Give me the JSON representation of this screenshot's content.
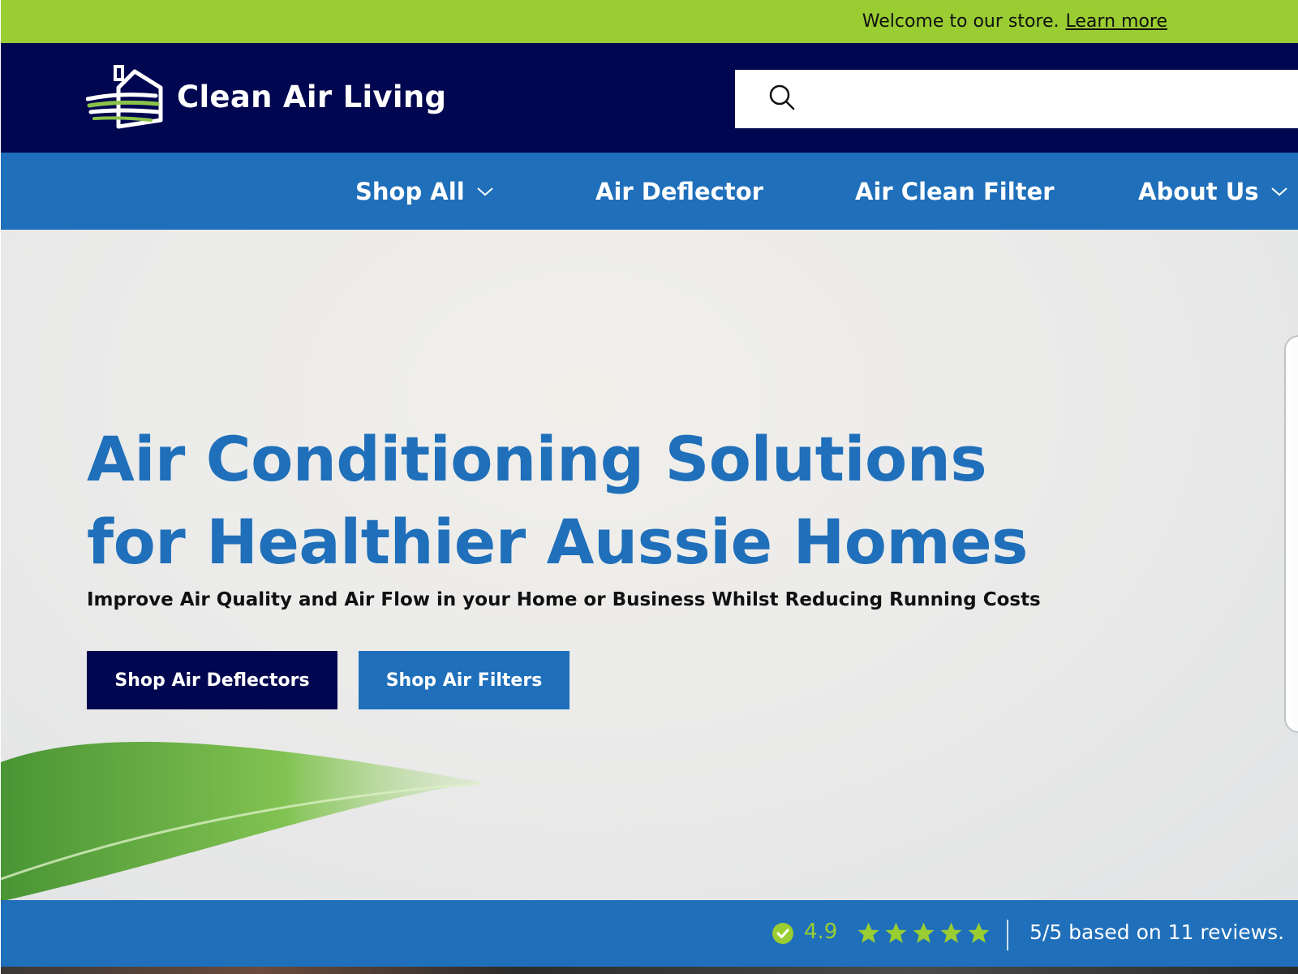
{
  "announcement": {
    "text": "Welcome to our store.",
    "link_label": "Learn more"
  },
  "header": {
    "brand": "Clean Air Living",
    "search": {
      "placeholder": "",
      "icon": "search-icon"
    }
  },
  "nav": {
    "items": [
      {
        "label": "Shop All",
        "has_dropdown": true
      },
      {
        "label": "Air Deflector",
        "has_dropdown": false
      },
      {
        "label": "Air Clean Filter",
        "has_dropdown": false
      },
      {
        "label": "About Us",
        "has_dropdown": true
      }
    ]
  },
  "hero": {
    "title_line1": "Air Conditioning Solutions",
    "title_line2": "for Healthier Aussie Homes",
    "subtitle": "Improve Air Quality and Air Flow in your Home or Business Whilst Reducing Running Costs",
    "buttons": {
      "primary": "Shop Air Deflectors",
      "secondary": "Shop Air Filters"
    }
  },
  "reviews": {
    "rating": "4.9",
    "stars": 5,
    "summary": "5/5 based on 11 reviews."
  },
  "colors": {
    "lime": "#9acd32",
    "navy": "#00064f",
    "blue": "#1f6fba"
  }
}
